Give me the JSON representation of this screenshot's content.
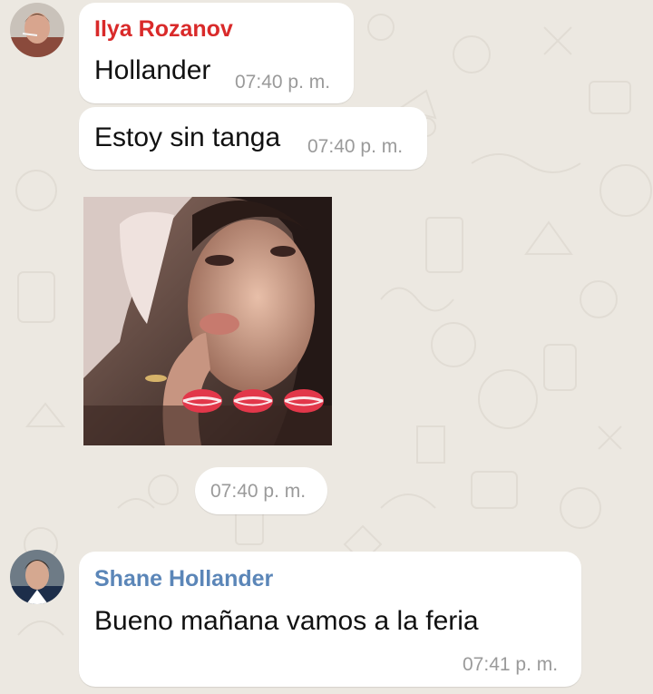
{
  "colors": {
    "background": "#ece8e1",
    "bubble": "#ffffff",
    "sender_ilya": "#d92a2a",
    "sender_shane": "#5b86b8",
    "timestamp": "#9a9a9a"
  },
  "messages": [
    {
      "sender": "Ilya Rozanov",
      "text": "Hollander",
      "time": "07:40 p. m."
    },
    {
      "text": "Estoy sin tanga",
      "time": "07:40 p. m."
    },
    {
      "type": "photo",
      "photo_icon": "lips-emoji-icon",
      "time": "07:40 p. m."
    },
    {
      "sender": "Shane Hollander",
      "text": "Bueno mañana vamos a la feria",
      "time": "07:41 p. m."
    }
  ]
}
